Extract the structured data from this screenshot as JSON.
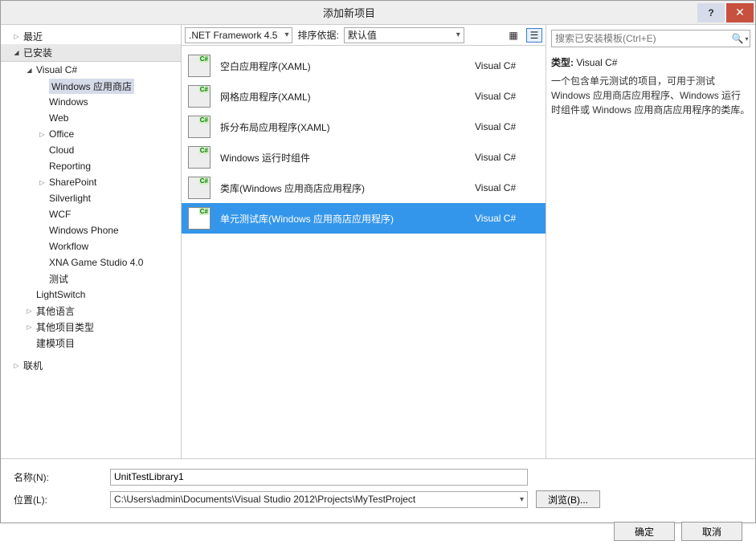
{
  "title": "添加新项目",
  "help_tooltip": "?",
  "close_icon": "✕",
  "sidebar": {
    "recent": "最近",
    "installed": "已安装",
    "visual_csharp": "Visual C#",
    "windows_store": "Windows 应用商店",
    "windows": "Windows",
    "web": "Web",
    "office": "Office",
    "cloud": "Cloud",
    "reporting": "Reporting",
    "sharepoint": "SharePoint",
    "silverlight": "Silverlight",
    "wcf": "WCF",
    "windows_phone": "Windows Phone",
    "workflow": "Workflow",
    "xna": "XNA Game Studio 4.0",
    "test": "测试",
    "lightswitch": "LightSwitch",
    "other_lang": "其他语言",
    "other_proj": "其他项目类型",
    "model_proj": "建模项目",
    "online": "联机"
  },
  "toolbar": {
    "framework": ".NET Framework 4.5",
    "sort_label": "排序依据:",
    "sort_value": "默认值"
  },
  "templates": [
    {
      "name": "空白应用程序(XAML)",
      "lang": "Visual C#"
    },
    {
      "name": "网格应用程序(XAML)",
      "lang": "Visual C#"
    },
    {
      "name": "拆分布局应用程序(XAML)",
      "lang": "Visual C#"
    },
    {
      "name": "Windows 运行时组件",
      "lang": "Visual C#"
    },
    {
      "name": "类库(Windows 应用商店应用程序)",
      "lang": "Visual C#"
    },
    {
      "name": "单元测试库(Windows 应用商店应用程序)",
      "lang": "Visual C#"
    }
  ],
  "search": {
    "placeholder": "搜索已安装模板(Ctrl+E)"
  },
  "details": {
    "type_label": "类型:",
    "type_value": "Visual C#",
    "description": "一个包含单元测试的项目，可用于测试 Windows 应用商店应用程序、Windows 运行时组件或 Windows 应用商店应用程序的类库。"
  },
  "form": {
    "name_label": "名称(N):",
    "name_value": "UnitTestLibrary1",
    "location_label": "位置(L):",
    "location_value": "C:\\Users\\admin\\Documents\\Visual Studio 2012\\Projects\\MyTestProject",
    "browse": "浏览(B)..."
  },
  "buttons": {
    "ok": "确定",
    "cancel": "取消"
  }
}
